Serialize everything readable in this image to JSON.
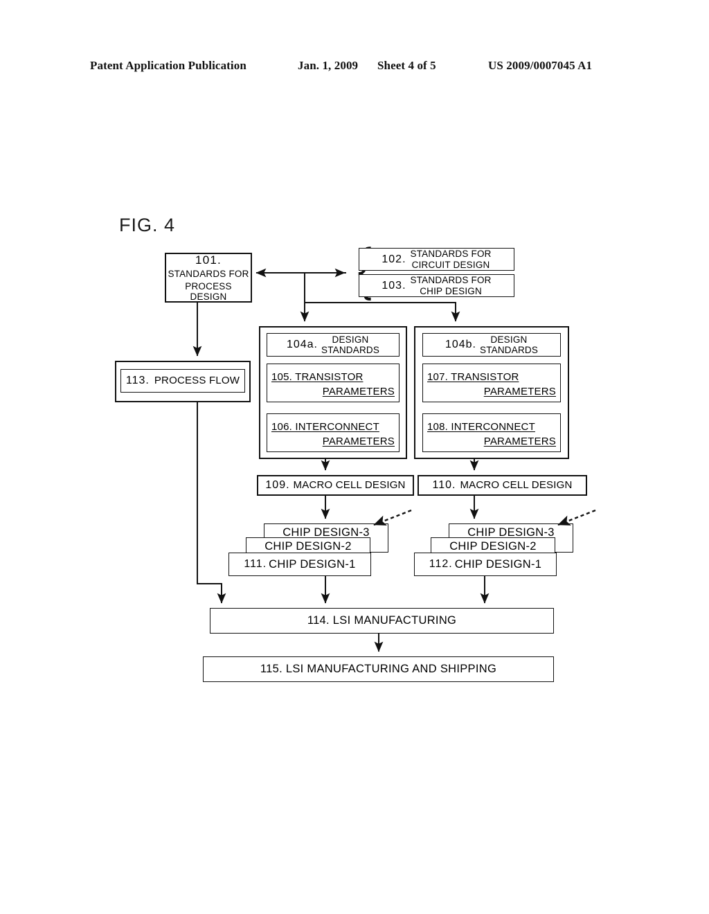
{
  "header": {
    "publication": "Patent Application Publication",
    "date": "Jan. 1, 2009",
    "sheet": "Sheet 4 of 5",
    "patent_number": "US 2009/0007045 A1"
  },
  "figure": {
    "label": "FIG. 4",
    "boxes": {
      "b101": {
        "num": "101.",
        "line1": "STANDARDS FOR",
        "line2": "PROCESS DESIGN"
      },
      "b102": {
        "num": "102.",
        "line1": "STANDARDS FOR",
        "line2": "CIRCUIT DESIGN"
      },
      "b103": {
        "num": "103.",
        "line1": "STANDARDS FOR",
        "line2": "CHIP DESIGN"
      },
      "b104a": {
        "num": "104a.",
        "line1": "DESIGN",
        "line2": "STANDARDS"
      },
      "b104b": {
        "num": "104b.",
        "line1": "DESIGN",
        "line2": "STANDARDS"
      },
      "b105": {
        "line1": "105. TRANSISTOR",
        "line2": "PARAMETERS"
      },
      "b106": {
        "line1": "106. INTERCONNECT",
        "line2": "PARAMETERS"
      },
      "b107": {
        "line1": "107.  TRANSISTOR",
        "line2": "PARAMETERS"
      },
      "b108": {
        "line1": "108. INTERCONNECT",
        "line2": "PARAMETERS"
      },
      "b109": {
        "num": "109.",
        "text": "MACRO CELL DESIGN"
      },
      "b110": {
        "num": "110.",
        "text": "MACRO CELL DESIGN"
      },
      "b111_3": {
        "text": "CHIP DESIGN-3"
      },
      "b111_2": {
        "text": "CHIP DESIGN-2"
      },
      "b111_1": {
        "num": "111.",
        "text": "CHIP DESIGN-1"
      },
      "b112_3": {
        "text": "CHIP DESIGN-3"
      },
      "b112_2": {
        "text": "CHIP DESIGN-2"
      },
      "b112_1": {
        "num": "112.",
        "text": "CHIP DESIGN-1"
      },
      "b113": {
        "num": "113.",
        "text": "PROCESS FLOW"
      },
      "b114": {
        "text": "114. LSI MANUFACTURING"
      },
      "b115": {
        "text": "115. LSI MANUFACTURING AND SHIPPING"
      }
    }
  },
  "colors": {
    "ink": "#111111",
    "paper": "#ffffff"
  }
}
